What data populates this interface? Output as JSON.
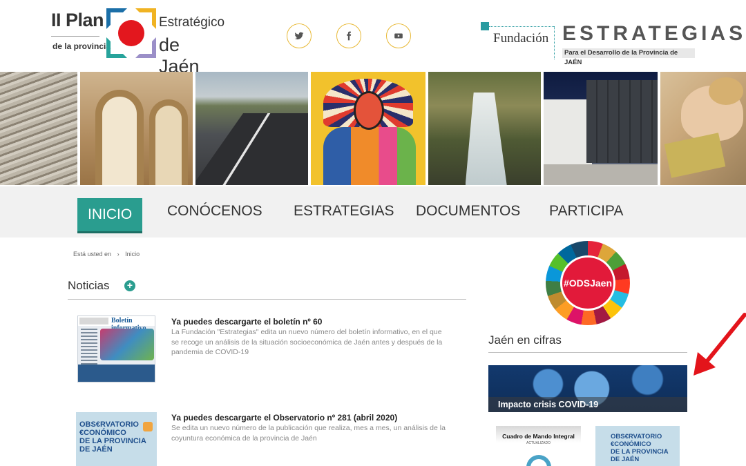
{
  "header": {
    "plan_logo": {
      "line1": "II Plan",
      "line2": "de la provincia",
      "line3": "Estratégico",
      "line4": "de Jaén"
    },
    "social": [
      {
        "name": "twitter-icon"
      },
      {
        "name": "facebook-icon"
      },
      {
        "name": "youtube-icon"
      }
    ],
    "fundacion_logo": {
      "word": "Fundación",
      "name": "ESTRATEGIAS",
      "subtitle": "Para el Desarrollo de la Provincia de JAÉN"
    }
  },
  "nav": {
    "items": [
      {
        "label": "INICIO",
        "active": true
      },
      {
        "label": "CONÓCENOS",
        "active": false
      },
      {
        "label": "ESTRATEGIAS",
        "active": false
      },
      {
        "label": "DOCUMENTOS",
        "active": false
      },
      {
        "label": "PARTICIPA",
        "active": false
      }
    ]
  },
  "breadcrumb": {
    "prefix": "Está usted en",
    "separator": "›",
    "current": "Inicio"
  },
  "news": {
    "heading": "Noticias",
    "add_symbol": "+",
    "items": [
      {
        "thumb_title": "Boletín informativo",
        "title": "Ya puedes descargarte el boletín nº 60",
        "body": "La Fundación \"Estrategias\" edita un nuevo número del boletín informativo, en el que se recoge un análisis de la situación socioeconómica de Jaén antes y después de la pandemia de COVID-19"
      },
      {
        "thumb_lines": [
          "OBS€RVATORIO",
          "€CONÓMICO",
          "DE LA PROVINCIA",
          "DE JAÉN"
        ],
        "title": "Ya puedes descargarte el Observatorio nº 281 (abril 2020)",
        "body": "Se edita un nuevo número de la publicación que realiza, mes a mes, un análisis de la coyuntura económica de la provincia de Jaén"
      }
    ]
  },
  "sidebar": {
    "ods_label": "#ODSJaen",
    "heading": "Jaén en cifras",
    "covid_caption": "Impacto crisis COVID-19",
    "card1_title": "Cuadro de Mando Integral",
    "card1_sub": "ACTUALIZADO",
    "card2_lines": [
      "OBS€RVATORIO",
      "€CONÓMICO",
      "DE LA PROVINCIA",
      "DE JAÉN"
    ]
  },
  "colors": {
    "accent": "#2a9d8f",
    "social_ring": "#e8b936",
    "arrow": "#e3141b"
  }
}
